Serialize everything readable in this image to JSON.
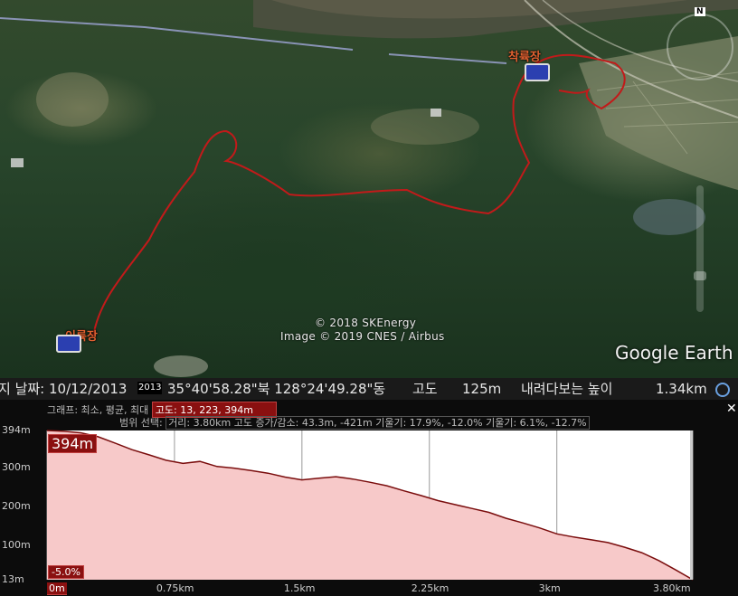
{
  "map": {
    "labels": {
      "landing": "착륙장",
      "takeoff": "이륙장"
    },
    "copyright_1": "© 2018 SKEnergy",
    "copyright_2": "Image © 2019 CNES / Airbus",
    "logo": "Google Earth",
    "north": "N"
  },
  "statusbar": {
    "date": "지 날짜: 10/12/2013",
    "year_tag": "2013",
    "coords": "35°40'58.28\"북 128°24'49.28\"동",
    "altitude_label": "고도",
    "altitude_value": "125m",
    "eye_label": "내려다보는 높이",
    "eye_value": "1.34km"
  },
  "elevation": {
    "graph_label": "그래프: 최소, 평균, 최대",
    "graph_values": "고도: 13, 223, 394m",
    "range_label": "범위 선택:",
    "range_stats": "거리: 3.80km 고도 증가/감소: 43.3m, -421m 기울기: 17.9%, -12.0% 기울기: 6.1%, -12.7%",
    "y_ticks": [
      "394m",
      "300m",
      "200m",
      "100m",
      "13m"
    ],
    "x_ticks": [
      "0m",
      "0.75km",
      "1.5km",
      "2.25km",
      "3km",
      "3.80km"
    ],
    "marker_max": "394m",
    "marker_slope": "-5.0%",
    "close": "✕"
  },
  "chart_data": {
    "type": "area",
    "xlabel": "",
    "ylabel": "",
    "ylim": [
      13,
      394
    ],
    "x_unit": "km",
    "x": [
      0,
      0.1,
      0.2,
      0.3,
      0.4,
      0.5,
      0.6,
      0.7,
      0.8,
      0.9,
      1.0,
      1.1,
      1.2,
      1.3,
      1.4,
      1.5,
      1.6,
      1.7,
      1.8,
      1.9,
      2.0,
      2.1,
      2.2,
      2.3,
      2.4,
      2.5,
      2.6,
      2.7,
      2.8,
      2.9,
      3.0,
      3.1,
      3.2,
      3.3,
      3.4,
      3.5,
      3.6,
      3.7,
      3.8
    ],
    "series": [
      {
        "values": [
          394,
          392,
          388,
          378,
          362,
          345,
          332,
          318,
          310,
          315,
          302,
          298,
          292,
          285,
          275,
          268,
          272,
          276,
          270,
          262,
          253,
          240,
          228,
          215,
          205,
          195,
          185,
          170,
          158,
          145,
          130,
          122,
          115,
          108,
          96,
          82,
          62,
          38,
          13
        ]
      }
    ]
  }
}
